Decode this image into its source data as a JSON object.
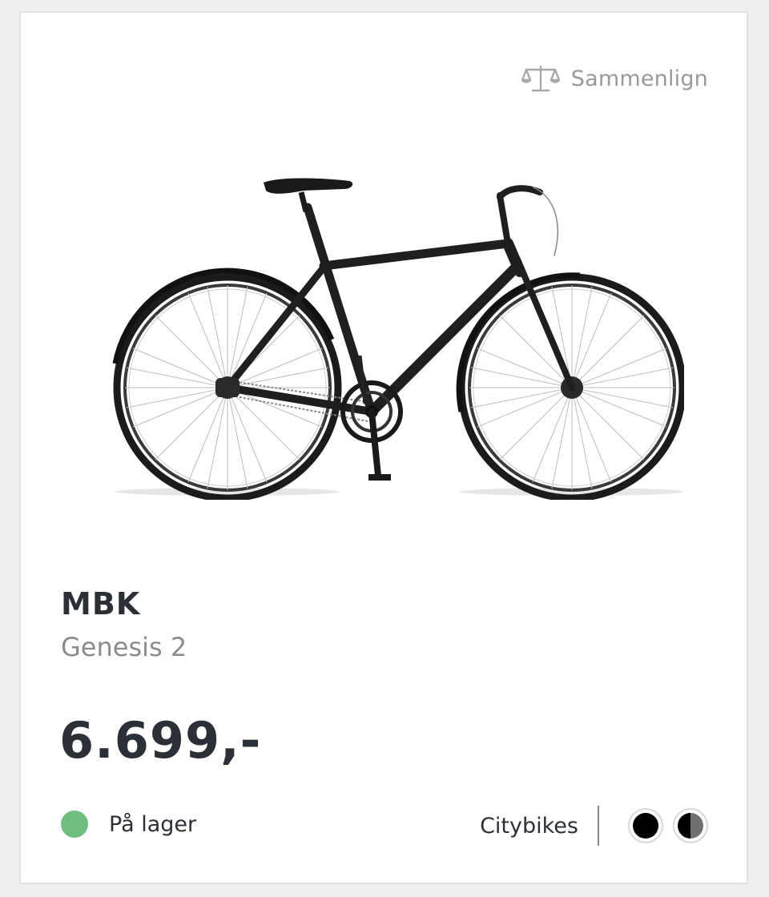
{
  "compare": {
    "label": "Sammenlign",
    "icon": "scale-icon"
  },
  "product": {
    "brand": "MBK",
    "model": "Genesis 2",
    "price": "6.699,-",
    "image_icon": "bicycle"
  },
  "stock": {
    "label": "På lager",
    "status_color": "#6fbe80"
  },
  "category": {
    "label": "Citybikes"
  },
  "colors": [
    {
      "name": "black",
      "hex": "#000000"
    },
    {
      "name": "black-grey",
      "hex": "#707070"
    }
  ]
}
